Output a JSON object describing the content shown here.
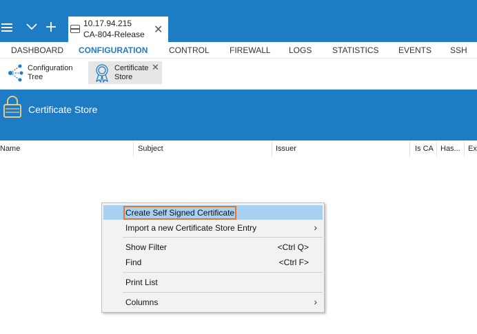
{
  "session_tab": {
    "ip": "10.17.94.215",
    "name": "CA-804-Release"
  },
  "nav": {
    "items": [
      "DASHBOARD",
      "CONFIGURATION",
      "CONTROL",
      "FIREWALL",
      "LOGS",
      "STATISTICS",
      "EVENTS",
      "SSH"
    ],
    "active": "CONFIGURATION"
  },
  "subtabs": {
    "tree": {
      "line1": "Configuration",
      "line2": "Tree"
    },
    "store": {
      "line1": "Certificate",
      "line2": "Store"
    }
  },
  "header": {
    "title": "Certificate Store"
  },
  "columns": [
    "Name",
    "Subject",
    "Issuer",
    "Is CA",
    "Has...",
    "Ex"
  ],
  "context_menu": {
    "items": [
      {
        "label": "Create Self Signed Certificate",
        "shortcut": "",
        "submenu": false,
        "highlighted": true
      },
      {
        "label": "Import a new Certificate Store Entry",
        "shortcut": "",
        "submenu": true
      },
      {
        "label": "Show Filter",
        "shortcut": "<Ctrl Q>",
        "submenu": false
      },
      {
        "label": "Find",
        "shortcut": "<Ctrl F>",
        "submenu": false
      },
      {
        "label": "Print List",
        "shortcut": "",
        "submenu": false
      },
      {
        "label": "Columns",
        "shortcut": "",
        "submenu": true
      }
    ]
  },
  "colors": {
    "brand_blue": "#1d7cc4",
    "highlight": "#a8d0f1",
    "focus_outline": "#e8732a"
  }
}
